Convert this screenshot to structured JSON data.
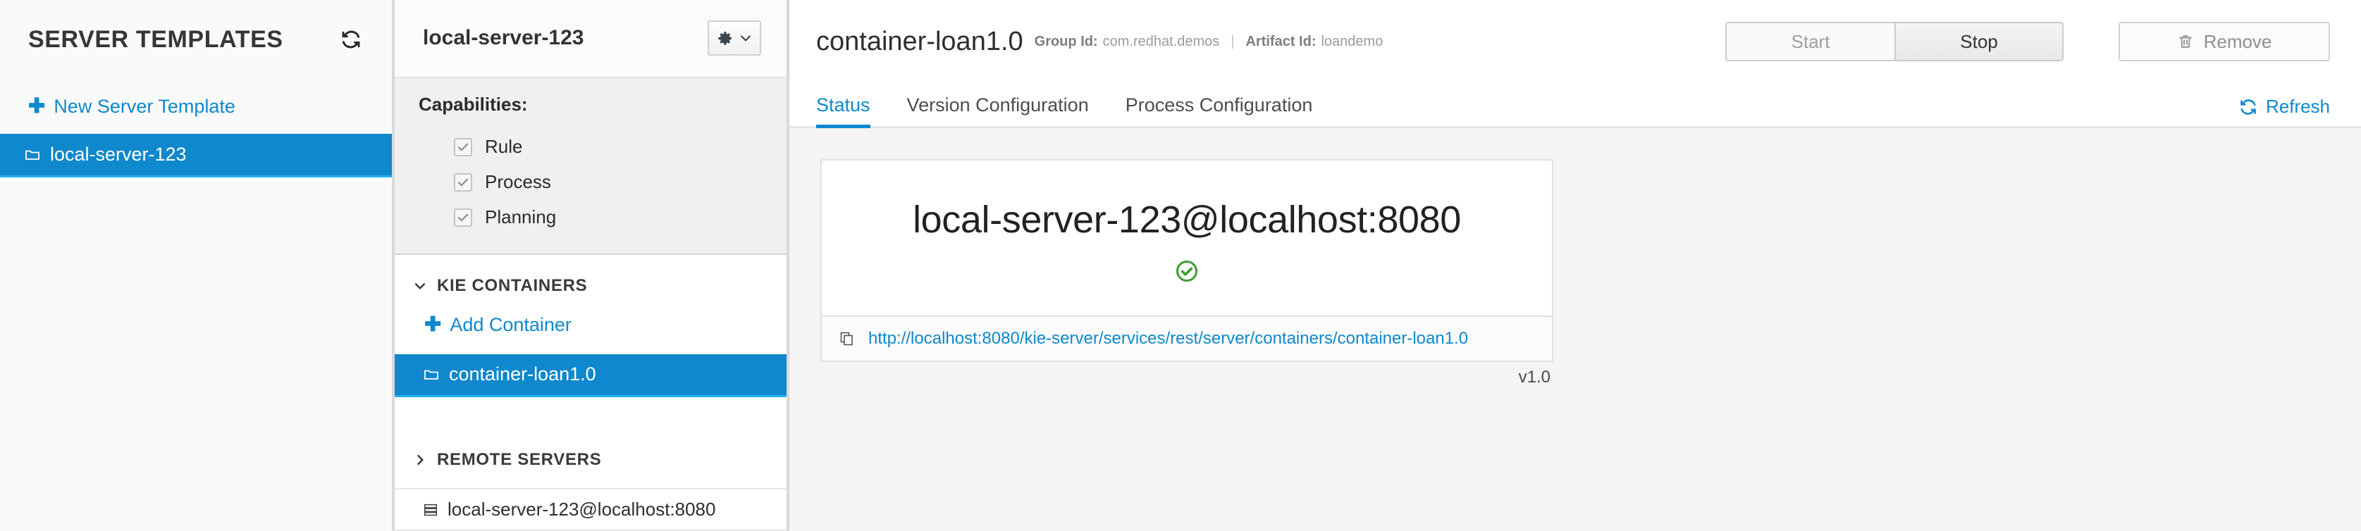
{
  "sidebar": {
    "title": "SERVER TEMPLATES",
    "refresh_icon": "refresh-icon",
    "new_template_label": "New Server Template",
    "templates": [
      {
        "label": "local-server-123",
        "icon": "folder-icon",
        "selected": true
      }
    ]
  },
  "midpanel": {
    "title": "local-server-123",
    "gear_icon": "gear-icon",
    "chevron_icon": "chevron-down-icon",
    "capabilities_label": "Capabilities:",
    "capabilities": [
      {
        "label": "Rule",
        "checked": true
      },
      {
        "label": "Process",
        "checked": true
      },
      {
        "label": "Planning",
        "checked": true
      }
    ],
    "kie_containers_label": "KIE CONTAINERS",
    "add_container_label": "Add Container",
    "containers": [
      {
        "label": "container-loan1.0",
        "icon": "folder-icon",
        "selected": true
      }
    ],
    "remote_servers_label": "REMOTE SERVERS",
    "remote_servers": [
      {
        "label": "local-server-123@localhost:8080",
        "icon": "server-icon"
      }
    ]
  },
  "main": {
    "title": "container-loan1.0",
    "group_id_label": "Group Id:",
    "group_id_value": "com.redhat.demos",
    "separator": "|",
    "artifact_id_label": "Artifact Id:",
    "artifact_id_value": "loandemo",
    "start_label": "Start",
    "stop_label": "Stop",
    "remove_label": "Remove",
    "remove_icon": "trash-icon",
    "tabs": [
      {
        "label": "Status",
        "active": true
      },
      {
        "label": "Version Configuration",
        "active": false
      },
      {
        "label": "Process Configuration",
        "active": false
      }
    ],
    "refresh_label": "Refresh",
    "refresh_icon": "refresh-icon",
    "status_card": {
      "server_name": "local-server-123@localhost:8080",
      "status_icon": "check-circle-icon",
      "status_color": "#3f9c35",
      "copy_icon": "copy-icon",
      "url": "http://localhost:8080/kie-server/services/rest/server/containers/container-loan1.0",
      "version": "v1.0"
    }
  },
  "colors": {
    "accent_blue": "#0f88ce",
    "selected_row": "#0f88ce",
    "success_green": "#3f9c35"
  }
}
